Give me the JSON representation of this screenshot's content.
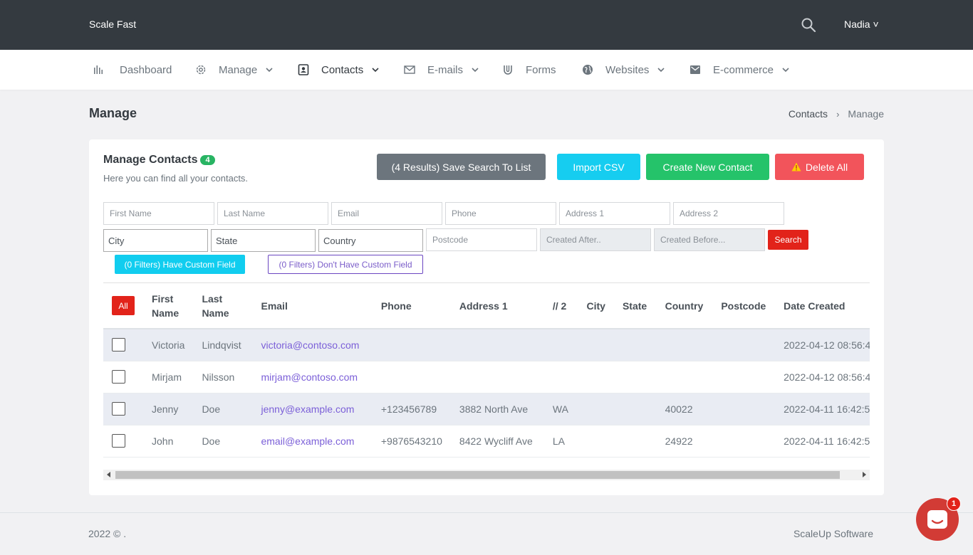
{
  "header": {
    "brand": "Scale Fast",
    "search_icon": "search-icon",
    "user": "Nadia ˅"
  },
  "nav": {
    "items": [
      {
        "label": "Dashboard",
        "icon": "bar-chart-icon"
      },
      {
        "label": "Manage",
        "icon": "gear-icon"
      },
      {
        "label": "Contacts",
        "icon": "contact-icon"
      },
      {
        "label": "E-mails",
        "icon": "mail-icon"
      },
      {
        "label": "Forms",
        "icon": "magnet-icon"
      },
      {
        "label": "Websites",
        "icon": "globe-icon"
      },
      {
        "label": "E-commerce",
        "icon": "envelope-icon"
      }
    ]
  },
  "page": {
    "title": "Manage",
    "breadcrumb": [
      "Contacts",
      "›",
      "Manage"
    ]
  },
  "card": {
    "title": "Manage Contacts",
    "count": "4",
    "subtitle": "Here you can find all your contacts.",
    "buttons": {
      "save": "(4 Results) Save Search To List",
      "import": "Import CSV",
      "create": "Create New Contact",
      "delete": "Delete All"
    },
    "filters": {
      "first_name": "First Name",
      "last_name": "Last Name",
      "email": "Email",
      "phone": "Phone",
      "address1": "Address 1",
      "address2": "Address 2",
      "city": "City",
      "state": "State",
      "country": "Country",
      "postcode": "Postcode",
      "created_after": "Created After..",
      "created_before": "Created Before...",
      "search": "Search",
      "have_custom": "(0 Filters) Have Custom Field",
      "dont_have_custom": "(0 Filters) Don't Have Custom Field"
    }
  },
  "table": {
    "all_label": "All",
    "columns": [
      "First Name",
      "Last Name",
      "Email",
      "Phone",
      "Address 1",
      "// 2",
      "City",
      "State",
      "Country",
      "Postcode",
      "Date Created"
    ],
    "rows": [
      {
        "first": "Victoria",
        "last": "Lindqvist",
        "email": "victoria@contoso.com",
        "phone": "",
        "address1": "",
        "address2": "",
        "city": "",
        "state": "",
        "country": "",
        "postcode": "",
        "date": "2022-04-12 08:56:4"
      },
      {
        "first": "Mirjam",
        "last": "Nilsson",
        "email": "mirjam@contoso.com",
        "phone": "",
        "address1": "",
        "address2": "",
        "city": "",
        "state": "",
        "country": "",
        "postcode": "",
        "date": "2022-04-12 08:56:4"
      },
      {
        "first": "Jenny",
        "last": "Doe",
        "email": "jenny@example.com",
        "phone": "+123456789",
        "address1": "3882 North Ave",
        "address2": "WA",
        "city": "",
        "state": "",
        "country": "40022",
        "postcode": "",
        "date": "2022-04-11 16:42:5"
      },
      {
        "first": "John",
        "last": "Doe",
        "email": "email@example.com",
        "phone": "+9876543210",
        "address1": "8422 Wycliff Ave",
        "address2": "LA",
        "city": "",
        "state": "",
        "country": "24922",
        "postcode": "",
        "date": "2022-04-11 16:42:5"
      }
    ]
  },
  "footer": {
    "left": "2022 © .",
    "right": "ScaleUp Software"
  },
  "chat": {
    "badge": "1"
  }
}
